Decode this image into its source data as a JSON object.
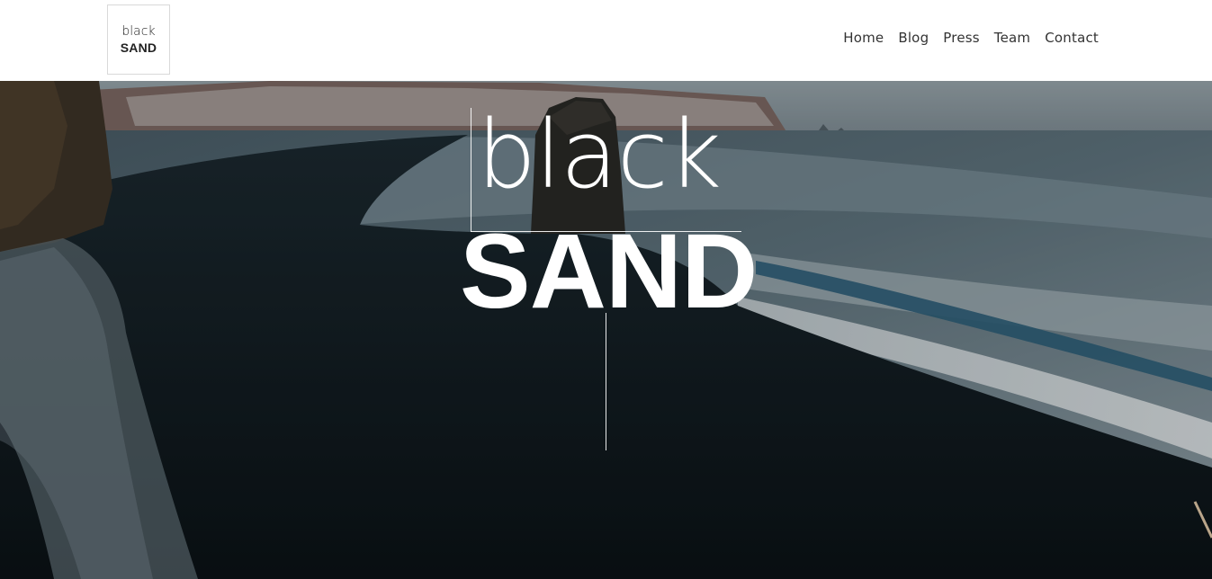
{
  "brand": {
    "line1": "black",
    "line2": "SAND"
  },
  "nav": {
    "items": [
      "Home",
      "Blog",
      "Press",
      "Team",
      "Contact"
    ]
  },
  "hero": {
    "title_light": "black",
    "title_bold": "SAND"
  },
  "colors": {
    "header_bg": "#ffffff",
    "nav_text": "#333333",
    "hero_text": "#ffffff",
    "sand": "#0f171b",
    "sea": "#5e7480"
  }
}
